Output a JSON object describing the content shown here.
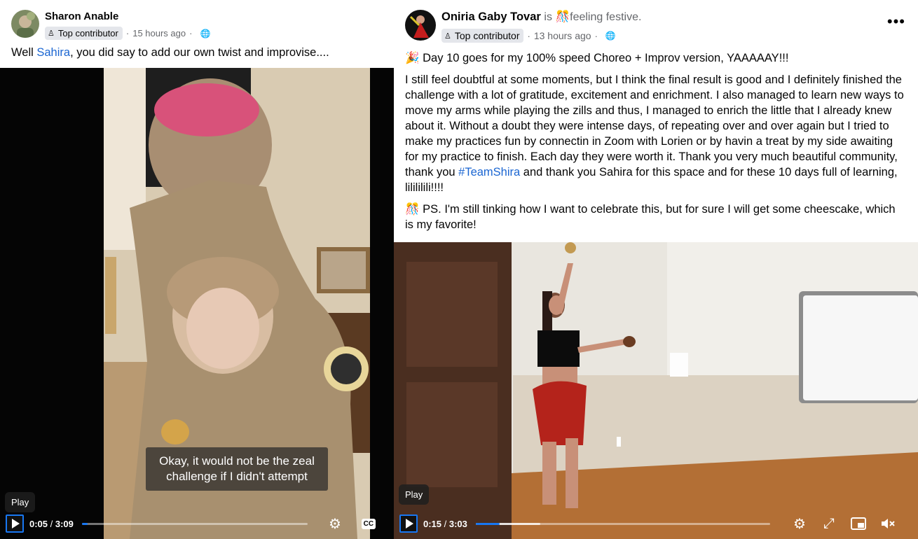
{
  "left_post": {
    "author": "Sharon Anable",
    "badge": "Top contributor",
    "timestamp": "15 hours ago",
    "audience_icon": "globe-icon",
    "text_before": "Well ",
    "mention": "Sahira",
    "text_after": ", you did say to add our own twist and improvise....",
    "video": {
      "caption_line1": "Okay, it would not be the zeal",
      "caption_line2": "challenge if I didn't attempt",
      "tooltip": "Play",
      "current_time": "0:05",
      "duration": "3:09",
      "progress": 0.026,
      "cc_label": "CC",
      "icons": [
        "play-icon",
        "settings-gear-icon",
        "closed-captions-icon"
      ]
    }
  },
  "right_post": {
    "author": "Oniria Gaby Tovar",
    "activity_verb": "is",
    "activity_emoji": "🎊",
    "activity": "feeling festive.",
    "badge": "Top contributor",
    "timestamp": "13 hours ago",
    "audience_icon": "globe-icon",
    "para1_emoji": "🎉",
    "para1": "Day 10 goes for my 100% speed Choreo + Improv version, YAAAAAY!!!",
    "para2_before": "I still feel doubtful at some moments, but I think the final result is good and I definitely finished the challenge with a lot of gratitude, excitement and enrichment. I also managed to learn new ways to move my arms while playing the zills and thus, I managed to enrich the little that I already knew about it. Without a doubt they were intense days, of repeating over and over again but I tried to make my practices fun by connectin in Zoom with Lorien or by havin a treat by my side awaiting for my practice to finish. Each day they were worth it. Thank you very much beautiful community, thank you ",
    "para2_hashtag": "#TeamShira",
    "para2_after": " and thank you Sahira for this space and for these 10 days full of learning, lilililili!!!!",
    "para3_emoji": "🎊",
    "para3": "PS. I'm still tinking how I want to celebrate this, but for sure I will get some cheescake, which is my favorite!",
    "video": {
      "tooltip": "Play",
      "current_time": "0:15",
      "duration": "3:03",
      "progress": 0.082,
      "buffered": 0.22,
      "icons": [
        "play-icon",
        "settings-gear-icon",
        "fullscreen-icon",
        "picture-in-picture-icon",
        "muted-volume-icon"
      ]
    }
  },
  "colors": {
    "link": "#1b66d2",
    "progress_fill": "#1877f2",
    "secondary_text": "#65676b",
    "badge_bg": "#e4e6eb"
  }
}
